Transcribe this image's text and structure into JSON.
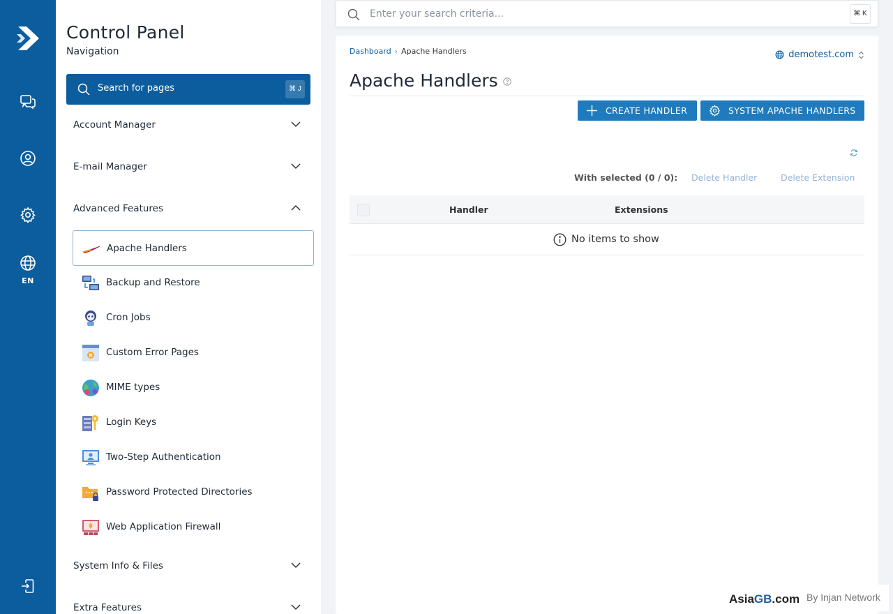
{
  "rail": {
    "language": "EN",
    "icons": [
      "logo-icon",
      "chat-icon",
      "user-icon",
      "gear-icon",
      "globe-icon",
      "logout-icon"
    ]
  },
  "nav": {
    "title": "Control Panel",
    "subtitle": "Navigation",
    "search_label": "Search for pages",
    "search_shortcut": "⌘ J",
    "sections_top": [
      {
        "label": "Account Manager",
        "expanded": false
      },
      {
        "label": "E-mail Manager",
        "expanded": false
      },
      {
        "label": "Advanced Features",
        "expanded": true
      }
    ],
    "items": [
      {
        "label": "Apache Handlers",
        "icon": "apache-feather-icon",
        "active": true
      },
      {
        "label": "Backup and Restore",
        "icon": "backup-icon",
        "active": false
      },
      {
        "label": "Cron Jobs",
        "icon": "cron-robot-icon",
        "active": false
      },
      {
        "label": "Custom Error Pages",
        "icon": "error-page-icon",
        "active": false
      },
      {
        "label": "MIME types",
        "icon": "mime-globe-icon",
        "active": false
      },
      {
        "label": "Login Keys",
        "icon": "key-icon",
        "active": false
      },
      {
        "label": "Two-Step Authentication",
        "icon": "two-step-auth-icon",
        "active": false
      },
      {
        "label": "Password Protected Directories",
        "icon": "protected-folder-icon",
        "active": false
      },
      {
        "label": "Web Application Firewall",
        "icon": "firewall-icon",
        "active": false
      }
    ],
    "sections_bottom": [
      {
        "label": "System Info & Files",
        "expanded": false
      },
      {
        "label": "Extra Features",
        "expanded": false
      }
    ]
  },
  "topbar": {
    "search_placeholder": "Enter your search criteria...",
    "search_shortcut": "⌘ K"
  },
  "main": {
    "breadcrumb": [
      "Dashboard",
      "Apache Handlers"
    ],
    "domain": "demotest.com",
    "title": "Apache Handlers",
    "buttons": {
      "create": "CREATE HANDLER",
      "system": "SYSTEM APACHE HANDLERS"
    },
    "with_selected": "With selected (0 / 0):",
    "actions": [
      "Delete Handler",
      "Delete Extension"
    ],
    "table": {
      "columns": [
        "Handler",
        "Extensions"
      ],
      "rows": [],
      "empty_text": "No items to show"
    }
  },
  "footer": {
    "brand_prefix": "Asia",
    "brand_highlight": "GB",
    "brand_suffix": ".com",
    "by_text": "By Injan Network"
  },
  "colors": {
    "primary": "#0c5d9e",
    "button": "#1f7bbd",
    "action_disabled": "#94b4d4",
    "background": "#f1f3f6"
  }
}
